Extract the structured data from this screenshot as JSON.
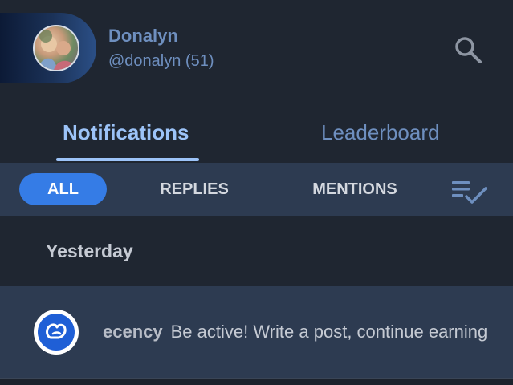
{
  "header": {
    "user_name": "Donalyn",
    "user_handle": "@donalyn (51)",
    "avatar_icon": "user-avatar-photo",
    "search_icon": "search-icon"
  },
  "main_tabs": [
    {
      "label": "Notifications",
      "active": true
    },
    {
      "label": "Leaderboard",
      "active": false
    }
  ],
  "filters": {
    "all": "ALL",
    "replies": "REPLIES",
    "mentions": "MENTIONS",
    "mark_read_icon": "mark-all-read-icon"
  },
  "section": {
    "title": "Yesterday"
  },
  "notifications": [
    {
      "source": "ecency",
      "message": "Be active! Write a post, continue earning",
      "icon": "ecency-logo-icon"
    }
  ],
  "colors": {
    "background": "#1f2631",
    "panel": "#2d3b51",
    "accent": "#357ce6",
    "active_tab": "#9cc3f8",
    "muted_text": "#6e8fbf"
  }
}
